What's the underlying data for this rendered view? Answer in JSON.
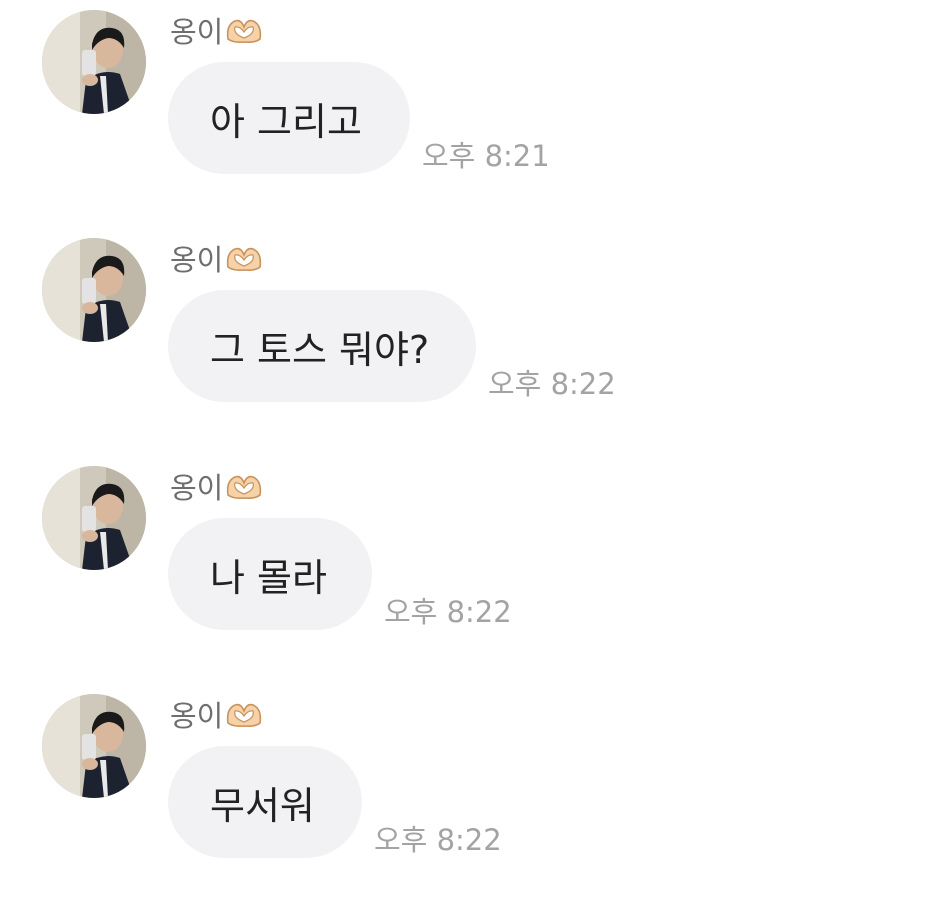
{
  "chat": {
    "messages": [
      {
        "sender": "옹이",
        "sender_emoji": "heart-hands-icon",
        "text": "아 그리고",
        "time": "오후 8:21"
      },
      {
        "sender": "옹이",
        "sender_emoji": "heart-hands-icon",
        "text": "그 토스 뭐야?",
        "time": "오후 8:22"
      },
      {
        "sender": "옹이",
        "sender_emoji": "heart-hands-icon",
        "text": "나 몰라",
        "time": "오후 8:22"
      },
      {
        "sender": "옹이",
        "sender_emoji": "heart-hands-icon",
        "text": "무서워",
        "time": "오후 8:22"
      }
    ]
  },
  "colors": {
    "bubble_bg": "#f2f2f4",
    "message_text": "#222222",
    "sender_text": "#6e6e6e",
    "time_text": "#a3a3a3",
    "background": "#ffffff"
  }
}
